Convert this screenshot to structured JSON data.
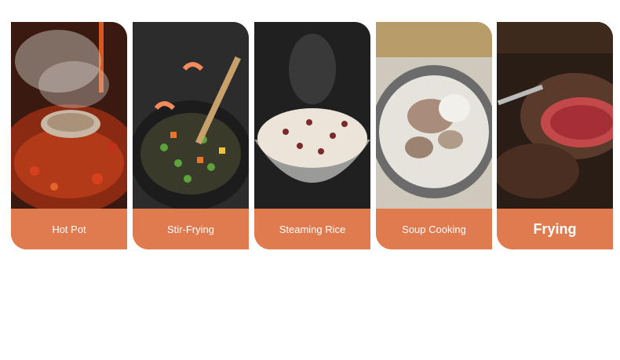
{
  "cards": [
    {
      "label": "Hot Pot",
      "icon": "hot-pot-photo"
    },
    {
      "label": "Stir-Frying",
      "icon": "stir-fry-photo"
    },
    {
      "label": "Steaming Rice",
      "icon": "steamed-rice-photo"
    },
    {
      "label": "Soup Cooking",
      "icon": "soup-photo"
    },
    {
      "label": "Frying",
      "icon": "steak-photo"
    }
  ],
  "colors": {
    "accent": "#e07a4f",
    "background": "#ffffff"
  }
}
